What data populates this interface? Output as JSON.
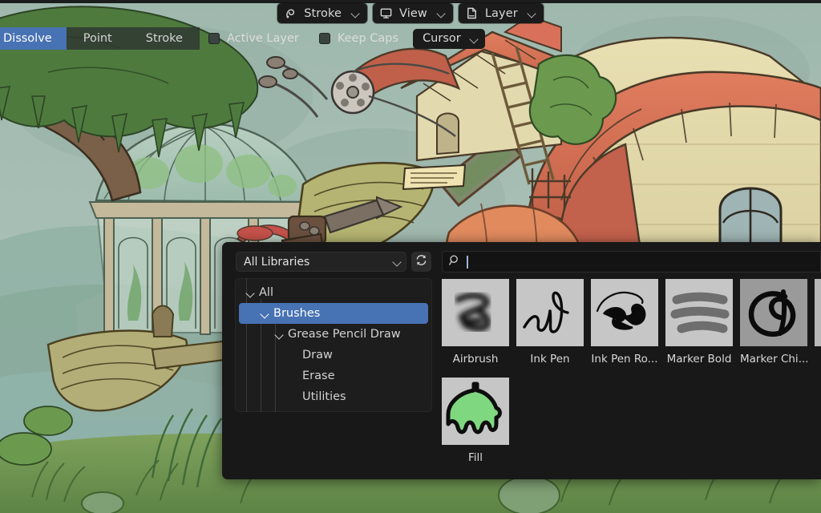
{
  "header": {
    "menus": [
      {
        "icon": "stroke-icon",
        "label": "Stroke"
      },
      {
        "icon": "view-monitor-icon",
        "label": "View"
      },
      {
        "icon": "layer-page-icon",
        "label": "Layer"
      }
    ]
  },
  "toolbar": {
    "segments": [
      {
        "label": "Dissolve",
        "active": true,
        "clipped": true
      },
      {
        "label": "Point",
        "active": false,
        "clipped": false
      },
      {
        "label": "Stroke",
        "active": false,
        "clipped": false
      }
    ],
    "checkboxes": [
      {
        "label": "Active Layer",
        "checked": false
      },
      {
        "label": "Keep Caps",
        "checked": false
      }
    ],
    "cursor_dropdown": {
      "label": "Cursor"
    }
  },
  "asset_browser": {
    "library_select": {
      "value": "All Libraries"
    },
    "refresh_icon": "refresh-icon",
    "search": {
      "value": "",
      "placeholder": "",
      "icon": "search-icon"
    },
    "tree": [
      {
        "label": "All",
        "depth": 0,
        "expanded": true,
        "selected": false,
        "has_children": true
      },
      {
        "label": "Brushes",
        "depth": 1,
        "expanded": true,
        "selected": true,
        "has_children": true
      },
      {
        "label": "Grease Pencil Draw",
        "depth": 2,
        "expanded": true,
        "selected": false,
        "has_children": true
      },
      {
        "label": "Draw",
        "depth": 3,
        "expanded": false,
        "selected": false,
        "has_children": false
      },
      {
        "label": "Erase",
        "depth": 3,
        "expanded": false,
        "selected": false,
        "has_children": false
      },
      {
        "label": "Utilities",
        "depth": 3,
        "expanded": false,
        "selected": false,
        "has_children": false
      }
    ],
    "assets": [
      {
        "label": "Airbrush",
        "thumb": "airbrush-thumb"
      },
      {
        "label": "Ink Pen",
        "thumb": "ink-pen-thumb"
      },
      {
        "label": "Ink Pen Ro...",
        "thumb": "ink-pen-rough-thumb"
      },
      {
        "label": "Marker Bold",
        "thumb": "marker-bold-thumb"
      },
      {
        "label": "Marker Chi...",
        "thumb": "marker-chisel-thumb"
      },
      {
        "label": "Fill",
        "thumb": "fill-thumb"
      }
    ]
  },
  "colors": {
    "accent_blue": "#4772b3",
    "panel_bg": "#181818",
    "pill_bg": "#1b1b1b",
    "thumb_bg": "#c6c6c6",
    "fill_green": "#7fd880"
  }
}
